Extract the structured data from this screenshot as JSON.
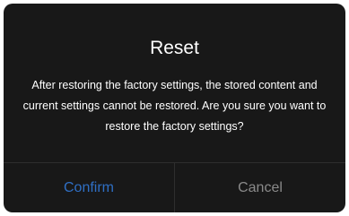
{
  "dialog": {
    "title": "Reset",
    "message": "After restoring the factory settings, the stored content and current settings cannot be restored. Are you sure you want to restore the factory settings?",
    "confirm_label": "Confirm",
    "cancel_label": "Cancel"
  },
  "colors": {
    "background": "#181818",
    "text": "#ffffff",
    "confirm": "#2f6fc4",
    "cancel": "#8a8a8a"
  }
}
